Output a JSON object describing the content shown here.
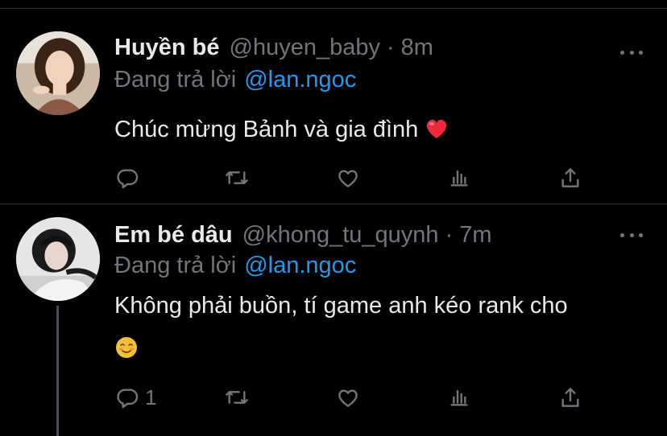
{
  "colors": {
    "background": "#000000",
    "text": "#e7e9ea",
    "secondary": "#71767b",
    "link": "#1d9bf0",
    "divider": "#2f3336",
    "heart": "#f0283c"
  },
  "tweets": [
    {
      "display_name": "Huyền bé",
      "handle": "@huyen_baby",
      "separator": "·",
      "time": "8m",
      "reply_prefix": "Đang trả lời",
      "reply_to": "@lan.ngoc",
      "text": "Chúc mừng Bảnh và gia đình",
      "emoji": "heart-emoji",
      "actions": {
        "reply_count": "",
        "icons": [
          "reply-icon",
          "retweet-icon",
          "like-icon",
          "stats-icon",
          "share-icon"
        ]
      }
    },
    {
      "display_name": "Em bé dâu",
      "handle": "@khong_tu_quynh",
      "separator": "·",
      "time": "7m",
      "reply_prefix": "Đang trả lời",
      "reply_to": "@lan.ngoc",
      "text": "Không phải buồn, tí game anh kéo rank cho",
      "emoji": "smiling-face-emoji",
      "actions": {
        "reply_count": "1",
        "icons": [
          "reply-icon",
          "retweet-icon",
          "like-icon",
          "stats-icon",
          "share-icon"
        ]
      }
    }
  ]
}
